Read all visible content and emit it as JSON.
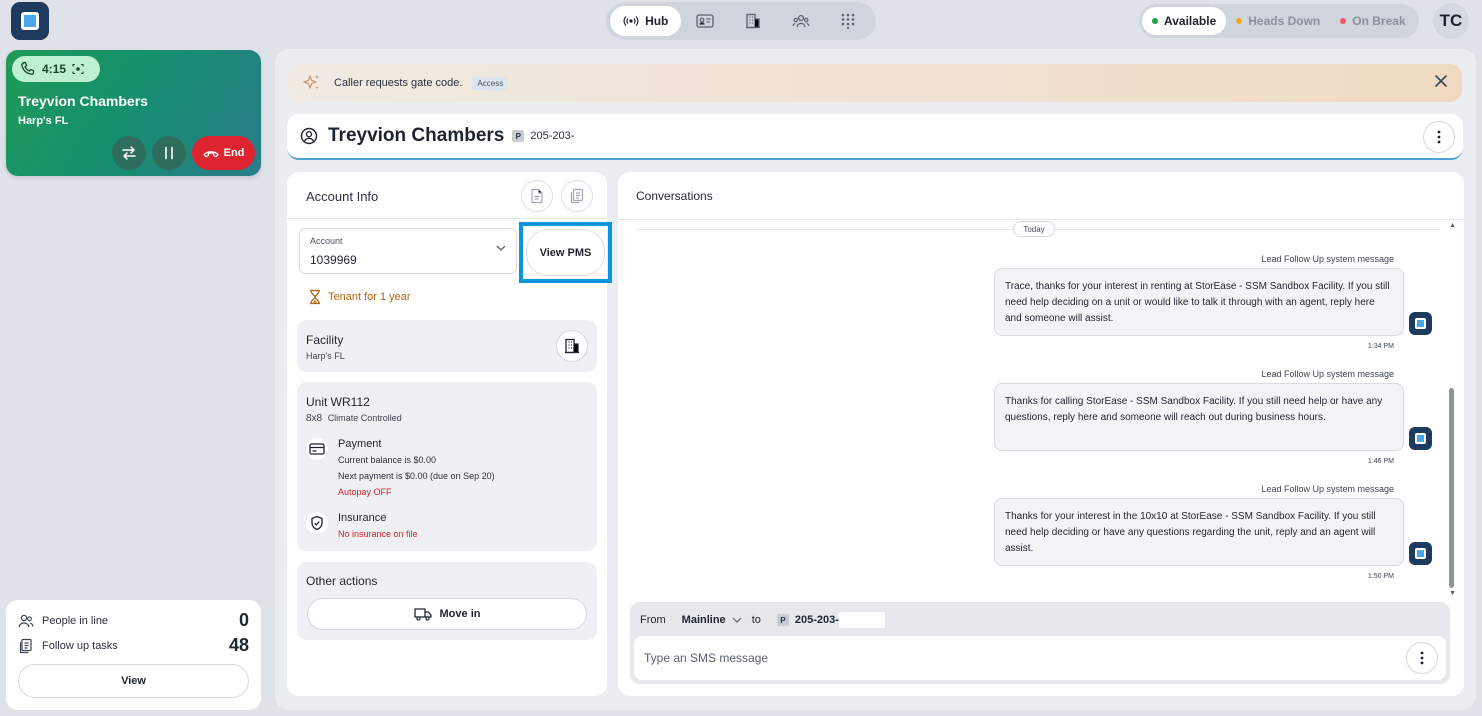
{
  "topbar": {
    "hub_label": "Hub",
    "status_options": [
      {
        "label": "Available",
        "color": "#1ca04b"
      },
      {
        "label": "Heads Down",
        "color": "#f0a91b"
      },
      {
        "label": "On Break",
        "color": "#e95c6b"
      }
    ],
    "user_initials": "TC"
  },
  "call": {
    "timer": "4:15",
    "caller_name": "Treyvion Chambers",
    "facility": "Harp's FL",
    "end_label": "End"
  },
  "queue": {
    "people_in_line_label": "People in line",
    "people_in_line_count": "0",
    "follow_up_label": "Follow up tasks",
    "follow_up_count": "48",
    "view_label": "View"
  },
  "notification": {
    "text": "Caller requests gate code.",
    "tag": "Access"
  },
  "customer": {
    "name": "Treyvion Chambers",
    "phone_badge": "P",
    "phone": "205-203-"
  },
  "account_info": {
    "title": "Account Info",
    "account_label": "Account",
    "account_value": "1039969",
    "view_pms_label": "View PMS",
    "tenant_text": "Tenant for 1 year",
    "facility_title": "Facility",
    "facility_name": "Harp's FL",
    "unit_title": "Unit WR112",
    "unit_size": "8x8",
    "unit_type": "Climate Controlled",
    "payment_title": "Payment",
    "payment_balance": "Current balance is $0.00",
    "payment_next": "Next payment is $0.00 (due on Sep 20)",
    "autopay": "Autopay OFF",
    "insurance_title": "Insurance",
    "insurance_status": "No insurance on file",
    "other_actions_title": "Other actions",
    "move_in_label": "Move in"
  },
  "conversations": {
    "title": "Conversations",
    "date_divider": "Today",
    "messages": [
      {
        "system": "Lead Follow Up system message",
        "text": "Trace, thanks for your interest in renting at StorEase - SSM Sandbox Facility. If you still need help deciding on a unit or would like to talk it through with an agent, reply here and someone will assist.",
        "time": "1:34 PM"
      },
      {
        "system": "Lead Follow Up system message",
        "text": "Thanks for calling StorEase - SSM Sandbox Facility. If you still need help or have any questions, reply here and someone will reach out during business hours.",
        "time": "1:46 PM"
      },
      {
        "system": "Lead Follow Up system message",
        "text": "Thanks for your interest in the 10x10 at StorEase - SSM Sandbox Facility. If you still need help deciding or have any questions regarding the unit, reply and an agent will assist.",
        "time": "1:50 PM"
      }
    ],
    "composer": {
      "from_label": "From",
      "from_value": "Mainline",
      "to_label": "to",
      "to_badge": "P",
      "to_value": "205-203-",
      "placeholder": "Type an SMS message"
    }
  }
}
